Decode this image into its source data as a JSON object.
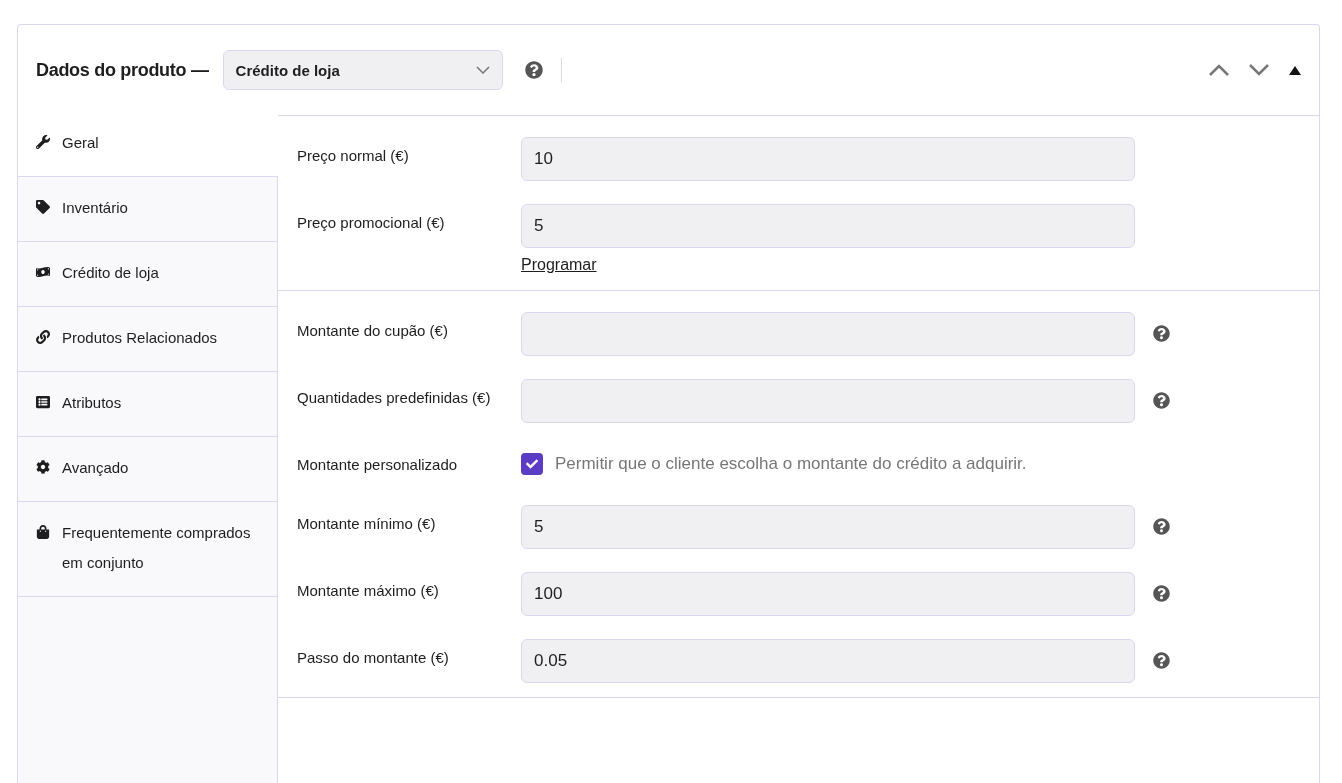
{
  "header": {
    "title": "Dados do produto —",
    "product_type": "Crédito de loja"
  },
  "tabs": [
    {
      "label": "Geral",
      "selected": true
    },
    {
      "label": "Inventário",
      "selected": false
    },
    {
      "label": "Crédito de loja",
      "selected": false
    },
    {
      "label": "Produtos Relacionados",
      "selected": false
    },
    {
      "label": "Atributos",
      "selected": false
    },
    {
      "label": "Avançado",
      "selected": false
    },
    {
      "label": "Frequentemente comprados em conjunto",
      "selected": false
    }
  ],
  "sections": [
    {
      "fields": [
        {
          "kind": "input",
          "label": "Preço normal (€)",
          "value": "10",
          "help": false
        },
        {
          "kind": "input",
          "label": "Preço promocional (€)",
          "value": "5",
          "help": false,
          "link": "Programar"
        }
      ]
    },
    {
      "fields": [
        {
          "kind": "input",
          "label": "Montante do cupão (€)",
          "help": true
        },
        {
          "kind": "input",
          "label": "Quantidades predefinidas (€)",
          "help": true
        },
        {
          "kind": "checkbox",
          "label": "Montante personalizado",
          "description": "Permitir que o cliente escolha o montante do crédito a adquirir.",
          "checked": true
        },
        {
          "kind": "input",
          "label": "Montante mínimo (€)",
          "value": "5",
          "help": true
        },
        {
          "kind": "input",
          "label": "Montante máximo (€)",
          "value": "100",
          "help": true
        },
        {
          "kind": "input",
          "label": "Passo do montante (€)",
          "value": "0.05",
          "help": true
        }
      ]
    }
  ]
}
